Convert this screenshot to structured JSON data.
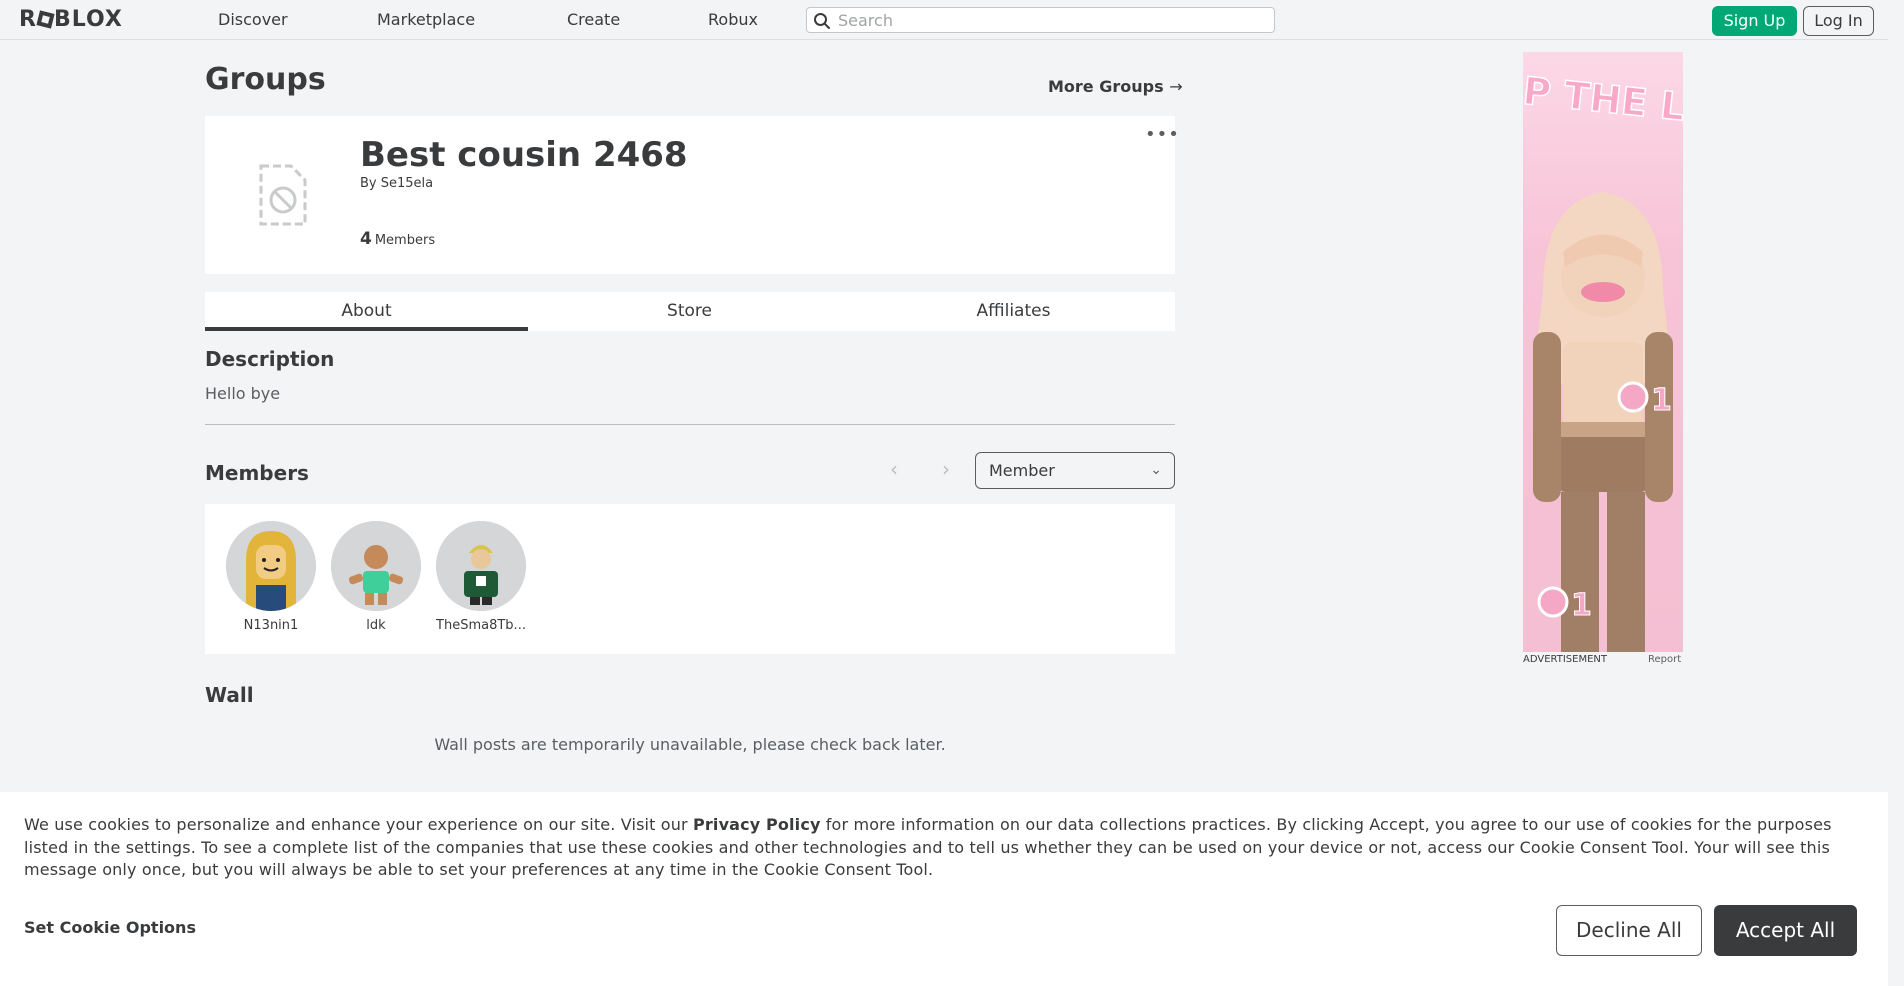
{
  "nav": {
    "logo": "ROBLOX",
    "links": [
      "Discover",
      "Marketplace",
      "Create",
      "Robux"
    ],
    "search_placeholder": "Search",
    "signup": "Sign Up",
    "login": "Log In"
  },
  "page": {
    "title": "Groups",
    "more_groups": "More Groups",
    "more_groups_arrow": "→"
  },
  "group": {
    "name": "Best cousin 2468",
    "by_label": "By",
    "owner": "Se15ela",
    "member_count": "4",
    "members_label": "Members",
    "more_menu": "•••"
  },
  "tabs": [
    "About",
    "Store",
    "Affiliates"
  ],
  "description": {
    "heading": "Description",
    "text": "Hello bye"
  },
  "members": {
    "heading": "Members",
    "prev": "‹",
    "next": "›",
    "role_selected": "Member",
    "list": [
      {
        "name": "N13nin1"
      },
      {
        "name": "ldk"
      },
      {
        "name": "TheSma8Tb..."
      }
    ]
  },
  "wall": {
    "heading": "Wall",
    "message": "Wall posts are temporarily unavailable, please check back later."
  },
  "ad": {
    "label": "ADVERTISEMENT",
    "report": "Report",
    "headline": "SHOP THE LOOK"
  },
  "cookie": {
    "text_before": "We use cookies to personalize and enhance your experience on our site. Visit our ",
    "privacy_link": "Privacy Policy",
    "text_after": " for more information on our data collections practices. By clicking Accept, you agree to our use of cookies for the purposes listed in the settings. To see a complete list of the companies that use these cookies and other technologies and to tell us whether they can be used on your device or not, access our Cookie Consent Tool. Your will see this message only once, but you will always be able to set your preferences at any time in the Cookie Consent Tool.",
    "settings": "Set Cookie Options",
    "decline": "Decline All",
    "accept": "Accept All"
  },
  "colors": {
    "page_bg": "#f2f4f5",
    "signup_green": "#00a876",
    "text_dark": "#393b3d",
    "accept_bg": "#393b3d"
  }
}
